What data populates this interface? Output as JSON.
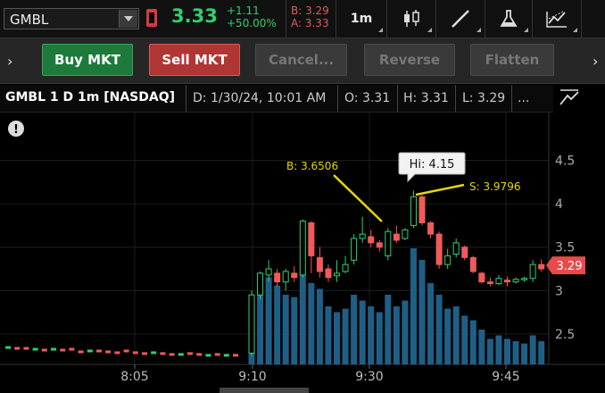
{
  "topbar": {
    "symbol": "GMBL",
    "last": "3.33",
    "change": "+1.11",
    "change_pct": "+50.00%",
    "bid": "B: 3.29",
    "ask": "A: 3.33",
    "timeframe": "1m",
    "icons": [
      "candles-style-icon",
      "drawing-line-icon",
      "studies-flask-icon",
      "patterns-icon"
    ]
  },
  "tradebar": {
    "buy": "Buy MKT",
    "sell": "Sell MKT",
    "cancel": "Cancel...",
    "reverse": "Reverse",
    "flatten": "Flatten"
  },
  "chart_header": {
    "title": "GMBL 1 D 1m [NASDAQ]",
    "date": "D: 1/30/24, 10:01 AM",
    "open": "O: 3.31",
    "high": "H: 3.31",
    "low": "L: 3.29",
    "more": "..."
  },
  "colors": {
    "up": "#2fcf6e",
    "down": "#f05a5a",
    "volume": "#1f5f86",
    "annotation": "#e8d600"
  },
  "chart_data": {
    "type": "candlestick",
    "y_ticks": [
      "2.5",
      "3",
      "3.5",
      "4",
      "4.5"
    ],
    "ylim": [
      2.15,
      5.05
    ],
    "x_ticks": [
      "8:05",
      "9:10",
      "9:30",
      "9:45"
    ],
    "last_price_tag": "3.29",
    "annotations": {
      "bid": "B: 3.6506",
      "sell": "S: 3.9796",
      "hi": "Hi: 4.15"
    },
    "premarket_points": [
      {
        "i": 0,
        "v": 2.35,
        "d": "up"
      },
      {
        "i": 1,
        "v": 2.34,
        "d": "dn"
      },
      {
        "i": 2,
        "v": 2.34,
        "d": "dn"
      },
      {
        "i": 3,
        "v": 2.33,
        "d": "up"
      },
      {
        "i": 4,
        "v": 2.32,
        "d": "dn"
      },
      {
        "i": 5,
        "v": 2.33,
        "d": "up"
      },
      {
        "i": 6,
        "v": 2.32,
        "d": "dn"
      },
      {
        "i": 7,
        "v": 2.33,
        "d": "dn"
      },
      {
        "i": 8,
        "v": 2.3,
        "d": "dn"
      },
      {
        "i": 9,
        "v": 2.31,
        "d": "up"
      },
      {
        "i": 10,
        "v": 2.31,
        "d": "dn"
      },
      {
        "i": 11,
        "v": 2.3,
        "d": "dn"
      },
      {
        "i": 12,
        "v": 2.29,
        "d": "dn"
      },
      {
        "i": 13,
        "v": 2.31,
        "d": "dn"
      },
      {
        "i": 14,
        "v": 2.29,
        "d": "dn"
      },
      {
        "i": 15,
        "v": 2.28,
        "d": "dn"
      },
      {
        "i": 16,
        "v": 2.29,
        "d": "up"
      },
      {
        "i": 17,
        "v": 2.28,
        "d": "dn"
      },
      {
        "i": 18,
        "v": 2.27,
        "d": "dn"
      },
      {
        "i": 19,
        "v": 2.27,
        "d": "up"
      },
      {
        "i": 20,
        "v": 2.28,
        "d": "dn"
      },
      {
        "i": 21,
        "v": 2.27,
        "d": "dn"
      },
      {
        "i": 22,
        "v": 2.26,
        "d": "up"
      },
      {
        "i": 23,
        "v": 2.27,
        "d": "dn"
      },
      {
        "i": 24,
        "v": 2.26,
        "d": "up"
      },
      {
        "i": 25,
        "v": 2.26,
        "d": "dn"
      }
    ],
    "candles": [
      {
        "o": 2.28,
        "h": 3.0,
        "l": 2.25,
        "c": 2.95
      },
      {
        "o": 2.95,
        "h": 3.22,
        "l": 2.9,
        "c": 3.2
      },
      {
        "o": 3.18,
        "h": 3.35,
        "l": 3.1,
        "c": 3.25
      },
      {
        "o": 3.2,
        "h": 3.25,
        "l": 3.05,
        "c": 3.1
      },
      {
        "o": 3.1,
        "h": 3.25,
        "l": 3.0,
        "c": 3.22
      },
      {
        "o": 3.2,
        "h": 3.28,
        "l": 3.1,
        "c": 3.15
      },
      {
        "o": 3.18,
        "h": 3.82,
        "l": 3.15,
        "c": 3.8
      },
      {
        "o": 3.78,
        "h": 3.8,
        "l": 3.2,
        "c": 3.4
      },
      {
        "o": 3.38,
        "h": 3.5,
        "l": 3.15,
        "c": 3.22
      },
      {
        "o": 3.25,
        "h": 3.3,
        "l": 3.1,
        "c": 3.15
      },
      {
        "o": 3.17,
        "h": 3.35,
        "l": 3.1,
        "c": 3.2
      },
      {
        "o": 3.22,
        "h": 3.4,
        "l": 3.2,
        "c": 3.3
      },
      {
        "o": 3.35,
        "h": 3.65,
        "l": 3.3,
        "c": 3.6
      },
      {
        "o": 3.6,
        "h": 3.85,
        "l": 3.55,
        "c": 3.65
      },
      {
        "o": 3.62,
        "h": 3.7,
        "l": 3.5,
        "c": 3.55
      },
      {
        "o": 3.55,
        "h": 3.58,
        "l": 3.45,
        "c": 3.5
      },
      {
        "o": 3.4,
        "h": 3.72,
        "l": 3.35,
        "c": 3.68
      },
      {
        "o": 3.65,
        "h": 3.75,
        "l": 3.55,
        "c": 3.58
      },
      {
        "o": 3.6,
        "h": 3.72,
        "l": 3.58,
        "c": 3.7
      },
      {
        "o": 3.75,
        "h": 4.15,
        "l": 3.72,
        "c": 4.08
      },
      {
        "o": 4.08,
        "h": 4.1,
        "l": 3.75,
        "c": 3.78
      },
      {
        "o": 3.78,
        "h": 3.8,
        "l": 3.6,
        "c": 3.65
      },
      {
        "o": 3.65,
        "h": 3.68,
        "l": 3.25,
        "c": 3.3
      },
      {
        "o": 3.3,
        "h": 3.48,
        "l": 3.25,
        "c": 3.4
      },
      {
        "o": 3.42,
        "h": 3.6,
        "l": 3.38,
        "c": 3.55
      },
      {
        "o": 3.5,
        "h": 3.52,
        "l": 3.35,
        "c": 3.38
      },
      {
        "o": 3.38,
        "h": 3.4,
        "l": 3.2,
        "c": 3.22
      },
      {
        "o": 3.2,
        "h": 3.22,
        "l": 3.08,
        "c": 3.1
      },
      {
        "o": 3.1,
        "h": 3.15,
        "l": 3.05,
        "c": 3.08
      },
      {
        "o": 3.08,
        "h": 3.18,
        "l": 3.06,
        "c": 3.14
      },
      {
        "o": 3.12,
        "h": 3.16,
        "l": 3.05,
        "c": 3.1
      },
      {
        "o": 3.1,
        "h": 3.15,
        "l": 3.08,
        "c": 3.13
      },
      {
        "o": 3.13,
        "h": 3.16,
        "l": 3.1,
        "c": 3.14
      },
      {
        "o": 3.14,
        "h": 3.35,
        "l": 3.1,
        "c": 3.3
      },
      {
        "o": 3.3,
        "h": 3.36,
        "l": 3.22,
        "c": 3.25
      }
    ],
    "volume_relative": [
      0.55,
      0.62,
      0.75,
      0.68,
      0.6,
      0.58,
      0.8,
      0.7,
      0.65,
      0.5,
      0.45,
      0.48,
      0.6,
      0.55,
      0.5,
      0.45,
      0.6,
      0.5,
      0.55,
      1.0,
      0.9,
      0.7,
      0.6,
      0.48,
      0.5,
      0.42,
      0.38,
      0.3,
      0.22,
      0.25,
      0.22,
      0.2,
      0.18,
      0.25,
      0.2
    ]
  }
}
